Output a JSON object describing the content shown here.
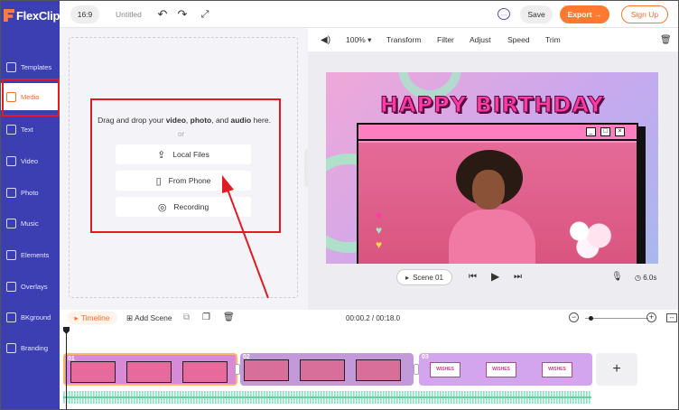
{
  "app": {
    "logo_text": "FlexClip",
    "brand_color": "#3b3fb1",
    "accent_color": "#ff7a2f"
  },
  "topbar": {
    "ratio": "16:9",
    "title": "Untitled",
    "save_label": "Save",
    "export_label": "Export →",
    "signup_label": "Sign Up"
  },
  "sidebar": {
    "items": [
      {
        "label": "Templates",
        "icon": "layers-icon"
      },
      {
        "label": "Media",
        "icon": "folder-icon",
        "active": true
      },
      {
        "label": "Text",
        "icon": "text-icon"
      },
      {
        "label": "Video",
        "icon": "video-icon"
      },
      {
        "label": "Photo",
        "icon": "image-icon"
      },
      {
        "label": "Music",
        "icon": "music-icon"
      },
      {
        "label": "Elements",
        "icon": "shapes-icon"
      },
      {
        "label": "Overlays",
        "icon": "overlays-icon"
      },
      {
        "label": "BKground",
        "icon": "background-icon"
      },
      {
        "label": "Branding",
        "icon": "branding-icon"
      }
    ]
  },
  "media": {
    "drop_prefix": "Drag and drop your",
    "drop_video": "video",
    "drop_photo": "photo",
    "drop_and": ", and",
    "drop_audio": "audio",
    "drop_suffix": "here.",
    "or": "or",
    "buttons": [
      {
        "label": "Local Files",
        "icon": "upload-icon"
      },
      {
        "label": "From Phone",
        "icon": "phone-icon"
      },
      {
        "label": "Recording",
        "icon": "record-icon"
      }
    ]
  },
  "edit_toolbar": {
    "zoom": "100%",
    "items": [
      "Transform",
      "Filter",
      "Adjust",
      "Speed",
      "Trim"
    ]
  },
  "preview": {
    "headline": "HAPPY BIRTHDAY",
    "scene_label": "Scene 01",
    "duration": "6.0s"
  },
  "timeline": {
    "tab_label": "Timeline",
    "add_scene_label": "Add Scene",
    "time_display": "00:00.2 / 00:18.0",
    "clips": [
      {
        "number": "01"
      },
      {
        "number": "02"
      },
      {
        "number": "03",
        "thumb_text": "WISHES"
      }
    ]
  }
}
